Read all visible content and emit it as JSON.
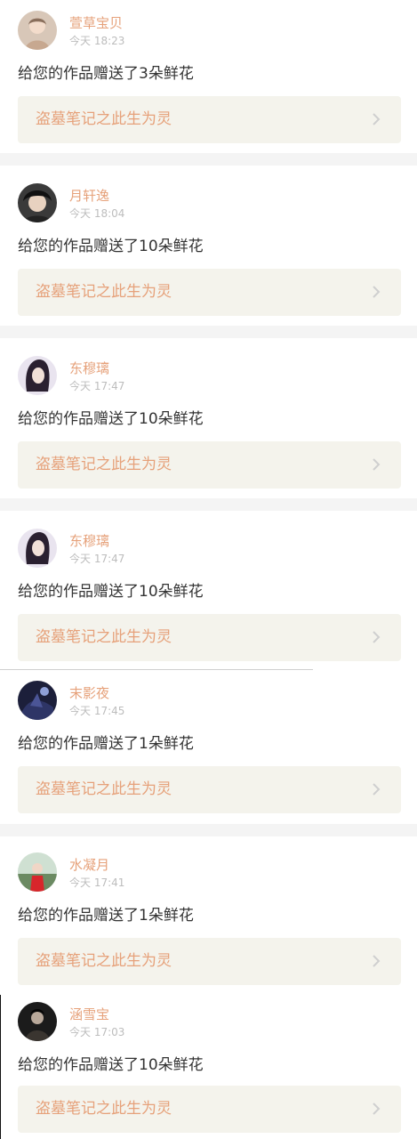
{
  "notifications": [
    {
      "name": "萱草宝贝",
      "time": "今天 18:23",
      "message": "给您的作品赠送了3朵鲜花",
      "work_title": "盗墓笔记之此生为灵",
      "avatar_icon": "user-avatar-icon"
    },
    {
      "name": "月轩逸",
      "time": "今天 18:04",
      "message": "给您的作品赠送了10朵鲜花",
      "work_title": "盗墓笔记之此生为灵",
      "avatar_icon": "user-avatar-icon"
    },
    {
      "name": "东穆璃",
      "time": "今天 17:47",
      "message": "给您的作品赠送了10朵鲜花",
      "work_title": "盗墓笔记之此生为灵",
      "avatar_icon": "user-avatar-icon"
    },
    {
      "name": "东穆璃",
      "time": "今天 17:47",
      "message": "给您的作品赠送了10朵鲜花",
      "work_title": "盗墓笔记之此生为灵",
      "avatar_icon": "user-avatar-icon"
    },
    {
      "name": "末影夜",
      "time": "今天 17:45",
      "message": "给您的作品赠送了1朵鲜花",
      "work_title": "盗墓笔记之此生为灵",
      "avatar_icon": "user-avatar-icon"
    },
    {
      "name": "水凝月",
      "time": "今天 17:41",
      "message": "给您的作品赠送了1朵鲜花",
      "work_title": "盗墓笔记之此生为灵",
      "avatar_icon": "user-avatar-icon"
    },
    {
      "name": "涵雪宝",
      "time": "今天 17:03",
      "message": "给您的作品赠送了10朵鲜花",
      "work_title": "盗墓笔记之此生为灵",
      "avatar_icon": "user-avatar-icon"
    }
  ],
  "colors": {
    "accent": "#e6a17a",
    "time_text": "#bdbdbd",
    "body_text": "#333333",
    "work_card_bg": "#f4f3ec",
    "separator": "#f4f4f4"
  }
}
